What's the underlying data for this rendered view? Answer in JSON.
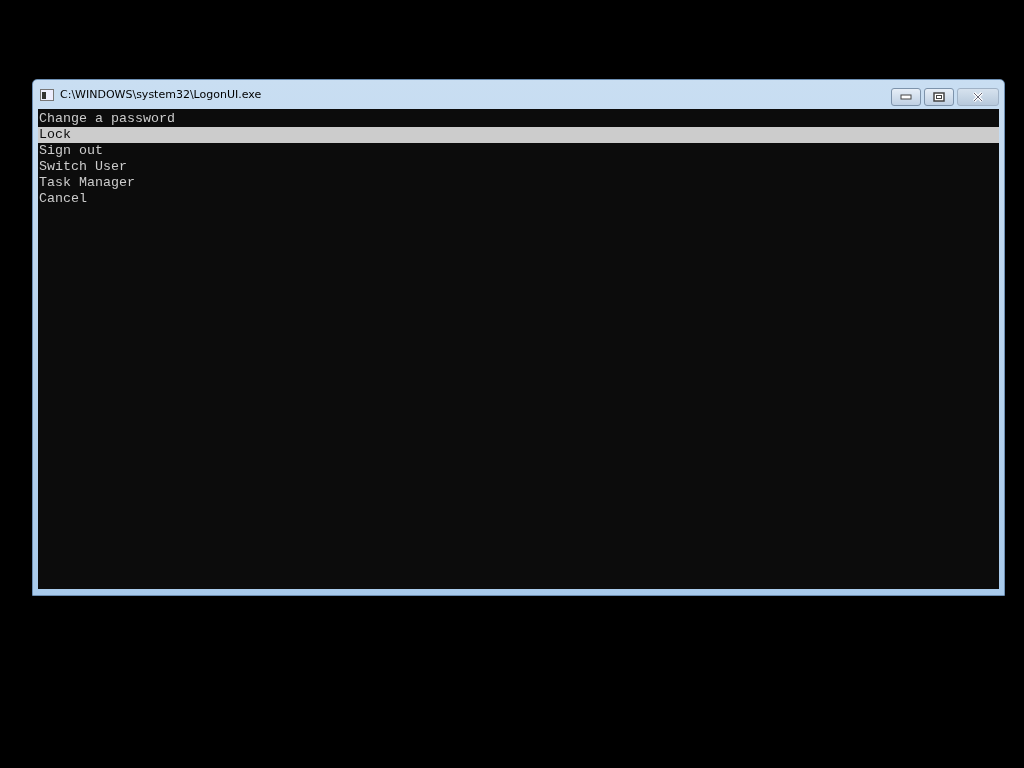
{
  "window": {
    "title": "C:\\WINDOWS\\system32\\LogonUI.exe"
  },
  "menu": {
    "items": [
      {
        "label": "Change a password",
        "selected": false
      },
      {
        "label": "Lock",
        "selected": true
      },
      {
        "label": "Sign out",
        "selected": false
      },
      {
        "label": "Switch User",
        "selected": false
      },
      {
        "label": "Task Manager",
        "selected": false
      },
      {
        "label": "Cancel",
        "selected": false
      }
    ]
  }
}
